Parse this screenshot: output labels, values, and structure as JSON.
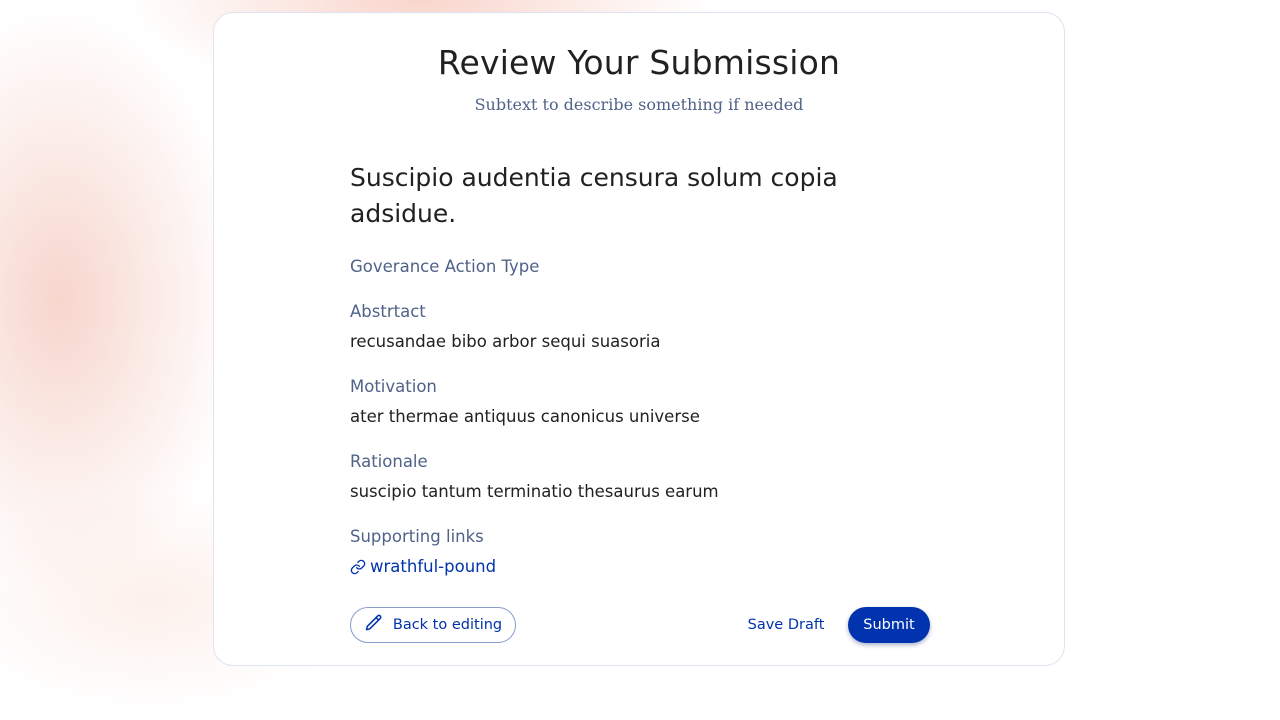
{
  "header": {
    "title": "Review Your Submission",
    "subtitle": "Subtext to describe something if needed"
  },
  "proposal": {
    "title": "Suscipio audentia censura solum copia adsidue.",
    "governance_action_type_label": "Goverance Action Type",
    "fields": [
      {
        "label": "Abstrtact",
        "value": "recusandae bibo arbor sequi suasoria"
      },
      {
        "label": "Motivation",
        "value": "ater thermae antiquus canonicus universe"
      },
      {
        "label": "Rationale",
        "value": "suscipio tantum terminatio thesaurus earum"
      }
    ],
    "supporting_links": {
      "label": "Supporting links",
      "links": [
        {
          "text": "wrathful-pound",
          "icon": "link-icon"
        }
      ]
    }
  },
  "actions": {
    "back_label": "Back to editing",
    "back_icon": "pencil-icon",
    "save_draft_label": "Save Draft",
    "submit_label": "Submit"
  },
  "colors": {
    "primary": "#0033ad",
    "text": "#212121",
    "muted": "#506288",
    "card_border": "#dfe2f0"
  }
}
